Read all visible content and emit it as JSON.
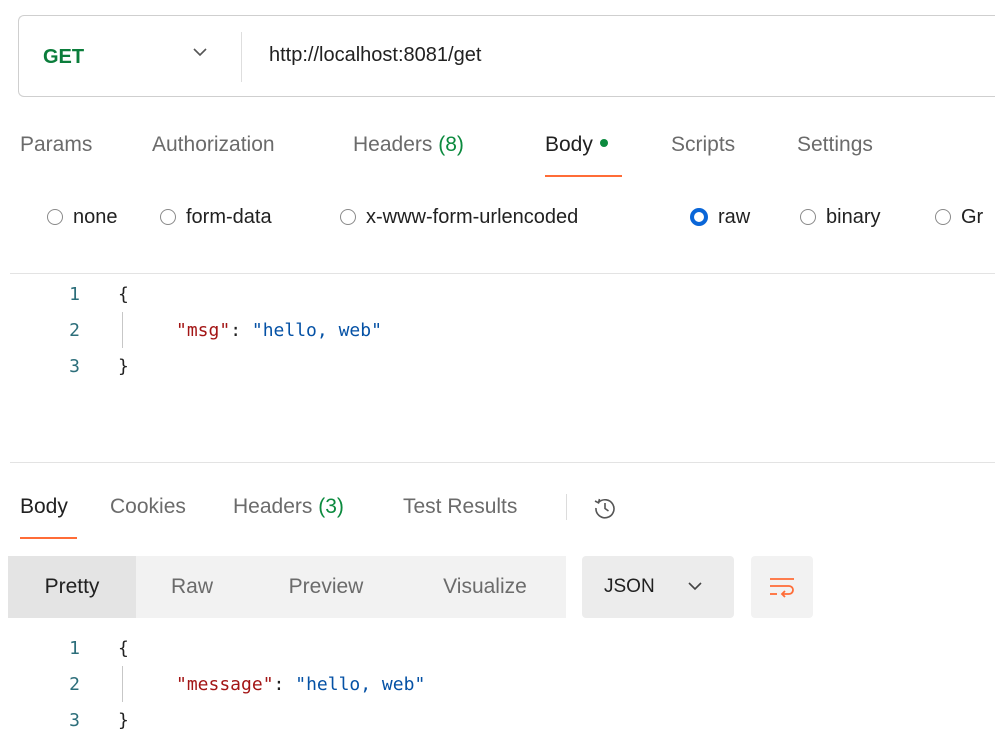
{
  "request": {
    "method": "GET",
    "url": "http://localhost:8081/get",
    "tabs": [
      {
        "label": "Params"
      },
      {
        "label": "Authorization"
      },
      {
        "label": "Headers",
        "count": "(8)"
      },
      {
        "label": "Body"
      },
      {
        "label": "Scripts"
      },
      {
        "label": "Settings"
      }
    ],
    "active_tab": "Body",
    "body_types": [
      "none",
      "form-data",
      "x-www-form-urlencoded",
      "raw",
      "binary",
      "Gr"
    ],
    "selected_body_type": "raw",
    "editor": {
      "line_numbers": [
        "1",
        "2",
        "3"
      ],
      "open": "{",
      "key": "\"msg\"",
      "colon": ": ",
      "value": "\"hello, web\"",
      "close": "}"
    }
  },
  "response": {
    "tabs": [
      {
        "label": "Body"
      },
      {
        "label": "Cookies"
      },
      {
        "label": "Headers",
        "count": "(3)"
      },
      {
        "label": "Test Results"
      }
    ],
    "active_tab": "Body",
    "view_modes": [
      "Pretty",
      "Raw",
      "Preview",
      "Visualize"
    ],
    "active_view": "Pretty",
    "format": "JSON",
    "editor": {
      "line_numbers": [
        "1",
        "2",
        "3"
      ],
      "open": "{",
      "key": "\"message\"",
      "colon": ": ",
      "value": "\"hello, web\"",
      "close": "}"
    }
  },
  "colors": {
    "method_get": "#0b7d3b",
    "accent_orange": "#ff6c37",
    "count_green": "#0b8a3e",
    "radio_selected": "#0a66d8",
    "json_key": "#a31515",
    "json_string": "#0451a5"
  },
  "icons": [
    "chevron-down-icon",
    "history-icon",
    "wrap-lines-icon"
  ]
}
